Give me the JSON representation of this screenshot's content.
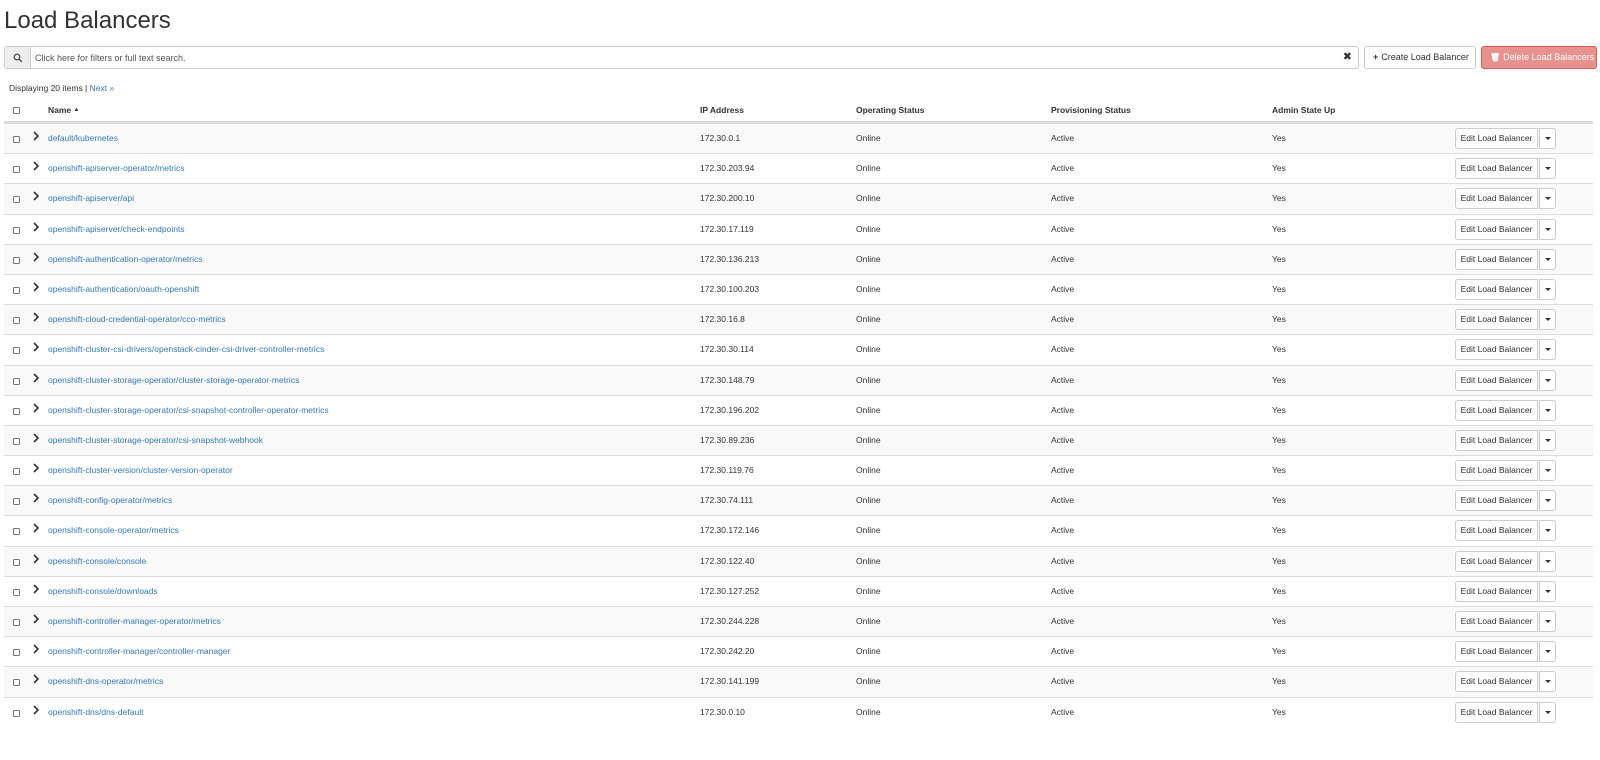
{
  "page": {
    "title": "Load Balancers"
  },
  "toolbar": {
    "search_placeholder": "Click here for filters or full text search.",
    "search_icon": "search-icon",
    "clear_icon": "times-icon",
    "clear_glyph": "✖",
    "create_icon": "plus-icon",
    "create_glyph": "+",
    "create_label": "Create Load Balancer",
    "delete_icon": "trash-icon",
    "delete_glyph": "🗑",
    "delete_label": "Delete Load Balancers"
  },
  "pagination": {
    "summary": "Displaying 20 items | ",
    "next": "Next »"
  },
  "table": {
    "columns": {
      "name": "Name",
      "sort_glyph": "▲",
      "ip": "IP Address",
      "operating": "Operating Status",
      "provisioning": "Provisioning Status",
      "admin": "Admin State Up"
    },
    "rows": [
      {
        "name": "default/kubernetes",
        "ip": "172.30.0.1",
        "operating": "Online",
        "provisioning": "Active",
        "admin": "Yes",
        "action": "Edit Load Balancer"
      },
      {
        "name": "openshift-apiserver-operator/metrics",
        "ip": "172.30.203.94",
        "operating": "Online",
        "provisioning": "Active",
        "admin": "Yes",
        "action": "Edit Load Balancer"
      },
      {
        "name": "openshift-apiserver/api",
        "ip": "172.30.200.10",
        "operating": "Online",
        "provisioning": "Active",
        "admin": "Yes",
        "action": "Edit Load Balancer"
      },
      {
        "name": "openshift-apiserver/check-endpoints",
        "ip": "172.30.17.119",
        "operating": "Online",
        "provisioning": "Active",
        "admin": "Yes",
        "action": "Edit Load Balancer"
      },
      {
        "name": "openshift-authentication-operator/metrics",
        "ip": "172.30.136.213",
        "operating": "Online",
        "provisioning": "Active",
        "admin": "Yes",
        "action": "Edit Load Balancer"
      },
      {
        "name": "openshift-authentication/oauth-openshift",
        "ip": "172.30.100.203",
        "operating": "Online",
        "provisioning": "Active",
        "admin": "Yes",
        "action": "Edit Load Balancer"
      },
      {
        "name": "openshift-cloud-credential-operator/cco-metrics",
        "ip": "172.30.16.8",
        "operating": "Online",
        "provisioning": "Active",
        "admin": "Yes",
        "action": "Edit Load Balancer"
      },
      {
        "name": "openshift-cluster-csi-drivers/openstack-cinder-csi-driver-controller-metrics",
        "ip": "172.30.30.114",
        "operating": "Online",
        "provisioning": "Active",
        "admin": "Yes",
        "action": "Edit Load Balancer"
      },
      {
        "name": "openshift-cluster-storage-operator/cluster-storage-operator-metrics",
        "ip": "172.30.148.79",
        "operating": "Online",
        "provisioning": "Active",
        "admin": "Yes",
        "action": "Edit Load Balancer"
      },
      {
        "name": "openshift-cluster-storage-operator/csi-snapshot-controller-operator-metrics",
        "ip": "172.30.196.202",
        "operating": "Online",
        "provisioning": "Active",
        "admin": "Yes",
        "action": "Edit Load Balancer"
      },
      {
        "name": "openshift-cluster-storage-operator/csi-snapshot-webhook",
        "ip": "172.30.89.236",
        "operating": "Online",
        "provisioning": "Active",
        "admin": "Yes",
        "action": "Edit Load Balancer"
      },
      {
        "name": "openshift-cluster-version/cluster-version-operator",
        "ip": "172.30.119.76",
        "operating": "Online",
        "provisioning": "Active",
        "admin": "Yes",
        "action": "Edit Load Balancer"
      },
      {
        "name": "openshift-config-operator/metrics",
        "ip": "172.30.74.111",
        "operating": "Online",
        "provisioning": "Active",
        "admin": "Yes",
        "action": "Edit Load Balancer"
      },
      {
        "name": "openshift-console-operator/metrics",
        "ip": "172.30.172.146",
        "operating": "Online",
        "provisioning": "Active",
        "admin": "Yes",
        "action": "Edit Load Balancer"
      },
      {
        "name": "openshift-console/console",
        "ip": "172.30.122.40",
        "operating": "Online",
        "provisioning": "Active",
        "admin": "Yes",
        "action": "Edit Load Balancer"
      },
      {
        "name": "openshift-console/downloads",
        "ip": "172.30.127.252",
        "operating": "Online",
        "provisioning": "Active",
        "admin": "Yes",
        "action": "Edit Load Balancer"
      },
      {
        "name": "openshift-controller-manager-operator/metrics",
        "ip": "172.30.244.228",
        "operating": "Online",
        "provisioning": "Active",
        "admin": "Yes",
        "action": "Edit Load Balancer"
      },
      {
        "name": "openshift-controller-manager/controller-manager",
        "ip": "172.30.242.20",
        "operating": "Online",
        "provisioning": "Active",
        "admin": "Yes",
        "action": "Edit Load Balancer"
      },
      {
        "name": "openshift-dns-operator/metrics",
        "ip": "172.30.141.199",
        "operating": "Online",
        "provisioning": "Active",
        "admin": "Yes",
        "action": "Edit Load Balancer"
      },
      {
        "name": "openshift-dns/dns-default",
        "ip": "172.30.0.10",
        "operating": "Online",
        "provisioning": "Active",
        "admin": "Yes",
        "action": "Edit Load Balancer"
      }
    ]
  },
  "colors": {
    "link": "#337ab7",
    "danger": "#d9534f",
    "stripe": "#f9f9f9",
    "border": "#dddddd"
  }
}
